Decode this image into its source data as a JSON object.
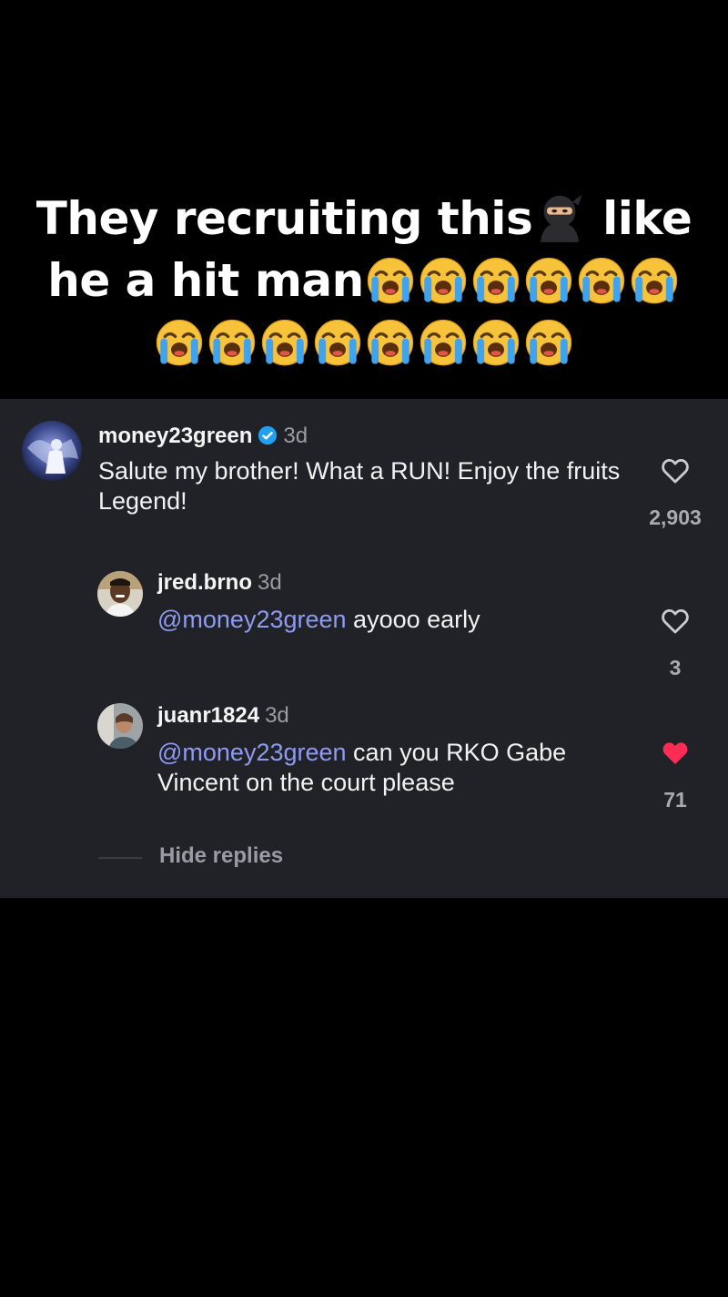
{
  "caption": {
    "line1_text_a": "They recruiting this",
    "line1_text_b": " like",
    "line2_text": "he a hit man",
    "icons": {
      "ninja": "ninja-emoji",
      "cry": "loudly-crying-face-emoji"
    },
    "line2_cry_count": 6,
    "line3_cry_count": 8
  },
  "comment": {
    "username": "money23green",
    "verified": true,
    "time": "3d",
    "text": "Salute my brother! What a RUN! Enjoy the fruits Legend!",
    "likes": "2,903",
    "liked": false
  },
  "replies": [
    {
      "username": "jred.brno",
      "time": "3d",
      "mention": "@money23green",
      "text": " ayooo early",
      "likes": "3",
      "liked": false
    },
    {
      "username": "juanr1824",
      "time": "3d",
      "mention": "@money23green",
      "text": " can you RKO Gabe Vincent on the court please",
      "likes": "71",
      "liked": true
    }
  ],
  "hide_replies_label": "Hide replies",
  "colors": {
    "background": "#000000",
    "panel": "#212227",
    "mention": "#8e9bf0",
    "liked_heart": "#fe2c55",
    "verified": "#20a0f0"
  }
}
